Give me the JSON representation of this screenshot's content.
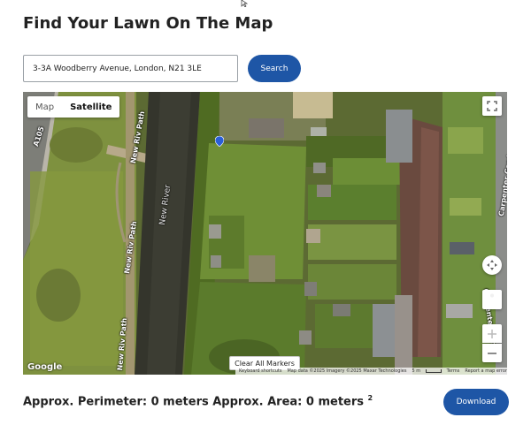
{
  "header": {
    "title": "Find Your Lawn On The Map"
  },
  "search": {
    "value": "3-3A Woodberry Avenue, London, N21 3LE",
    "button_label": "Search"
  },
  "map": {
    "type_options": [
      "Map",
      "Satellite"
    ],
    "selected_type": "Satellite",
    "road_labels": {
      "a105": "A105",
      "new_river_path_1": "New Riv Path",
      "new_river_path_2": "New Riv Path",
      "new_river_path_3": "New Riv Path",
      "new_river": "New River",
      "carpenter_gardens_1": "Carpenter Gardens",
      "carpenter_gardens_2": "Carpenter Gard"
    },
    "clear_button_label": "Clear All Markers",
    "logo_text": "Google",
    "attribution": {
      "shortcuts": "Keyboard shortcuts",
      "data": "Map data ©2025 Imagery ©2025 Maxar Technologies",
      "scale": "5 m",
      "terms": "Terms",
      "report": "Report a map error"
    },
    "icons": {
      "fullscreen": "fullscreen-icon",
      "pegman": "pegman-icon",
      "camera": "camera-control-icon",
      "zoom_in": "plus-icon",
      "zoom_out": "minus-icon",
      "marker": "map-pin-icon"
    }
  },
  "results": {
    "text": "Approx. Perimeter: 0 meters Approx. Area: 0 meters",
    "superscript": "2"
  },
  "download": {
    "label": "Download"
  },
  "colors": {
    "primary_button": "#1e56a6"
  }
}
